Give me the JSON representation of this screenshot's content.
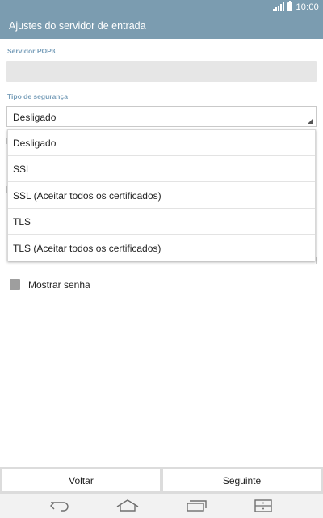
{
  "status_bar": {
    "time": "10:00",
    "icons": [
      "signal-icon",
      "battery-icon"
    ]
  },
  "header": {
    "title": "Ajustes do servidor de entrada"
  },
  "form": {
    "server_label": "Servidor POP3",
    "server_value": "",
    "security_label": "Tipo de segurança",
    "security_selected": "Desligado"
  },
  "dropdown": {
    "options": [
      "Desligado",
      "SSL",
      "SSL (Aceitar todos os certificados)",
      "TLS",
      "TLS (Aceitar todos os certificados)"
    ]
  },
  "show_password": {
    "label": "Mostrar senha",
    "checked": false
  },
  "buttons": {
    "back": "Voltar",
    "next": "Seguinte"
  },
  "nav_bar": {
    "icons": [
      "back-icon",
      "home-icon",
      "recent-apps-icon",
      "menu-icon"
    ]
  },
  "colors": {
    "header": "#7b9cb0",
    "label": "#7ba0bb",
    "field": "#e6e6e6"
  }
}
